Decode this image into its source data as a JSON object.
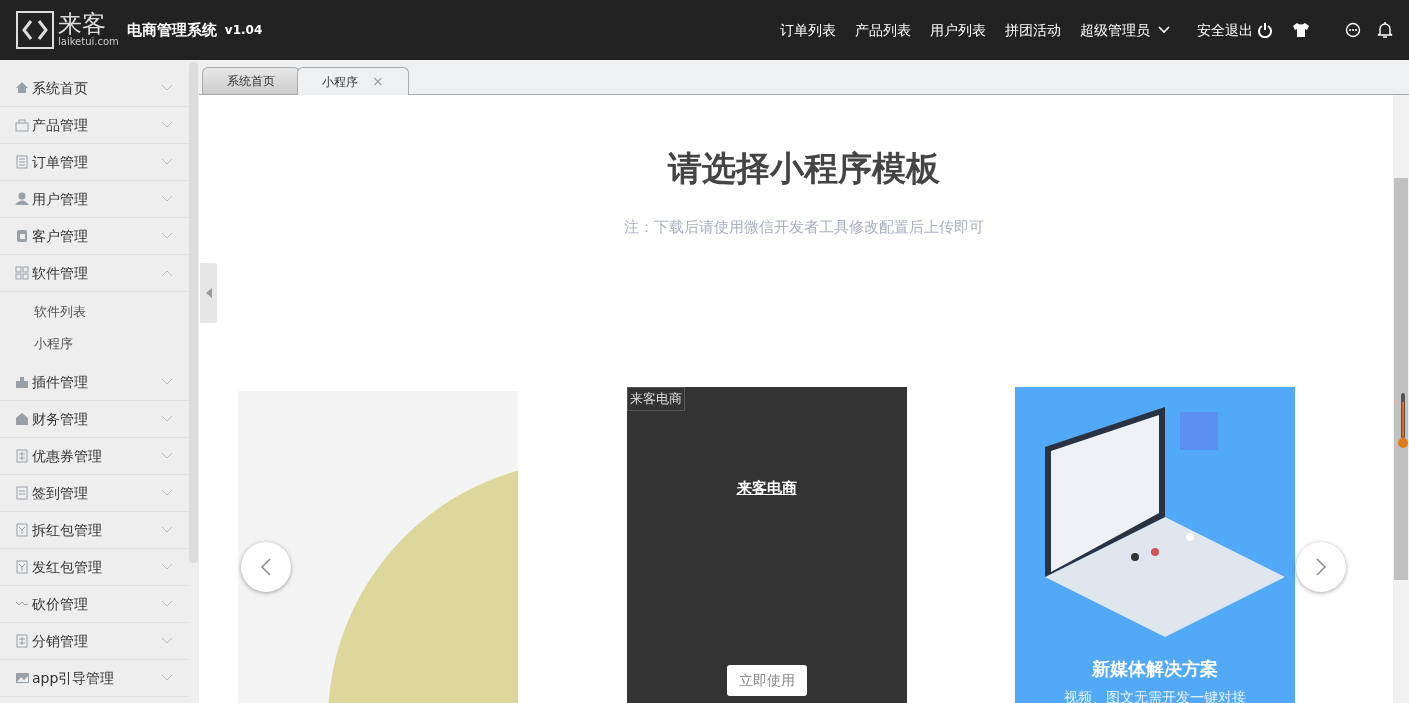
{
  "header": {
    "logo_text": "来客",
    "logo_domain": "laiketui.com",
    "title": "电商管理系统",
    "version": "v1.04",
    "nav": [
      "订单列表",
      "产品列表",
      "用户列表",
      "拼团活动"
    ],
    "user_menu": "超级管理员",
    "logout": "安全退出"
  },
  "sidebar": {
    "items": [
      {
        "label": "系统首页",
        "expanded": false
      },
      {
        "label": "产品管理",
        "expanded": false
      },
      {
        "label": "订单管理",
        "expanded": false
      },
      {
        "label": "用户管理",
        "expanded": false
      },
      {
        "label": "客户管理",
        "expanded": false
      },
      {
        "label": "软件管理",
        "expanded": true,
        "children": [
          {
            "label": "软件列表"
          },
          {
            "label": "小程序"
          }
        ]
      },
      {
        "label": "插件管理",
        "expanded": false
      },
      {
        "label": "财务管理",
        "expanded": false
      },
      {
        "label": "优惠券管理",
        "expanded": false
      },
      {
        "label": "签到管理",
        "expanded": false
      },
      {
        "label": "拆红包管理",
        "expanded": false
      },
      {
        "label": "发红包管理",
        "expanded": false
      },
      {
        "label": "砍价管理",
        "expanded": false
      },
      {
        "label": "分销管理",
        "expanded": false
      },
      {
        "label": "app引导管理",
        "expanded": false
      }
    ]
  },
  "tabs": [
    {
      "label": "系统首页",
      "selected": false
    },
    {
      "label": "小程序",
      "selected": true,
      "close": "×"
    }
  ],
  "page": {
    "title": "请选择小程序模板",
    "note": "注：下载后请使用微信开发者工具修改配置后上传即可"
  },
  "templates": [
    {
      "kind": "picture"
    },
    {
      "kind": "broken",
      "alt": "来客电商",
      "link": "来客电商",
      "button": "立即使用"
    },
    {
      "kind": "banner",
      "headline": "新媒体解决方案",
      "subline": "视频、图文无需开发一键对接"
    }
  ]
}
